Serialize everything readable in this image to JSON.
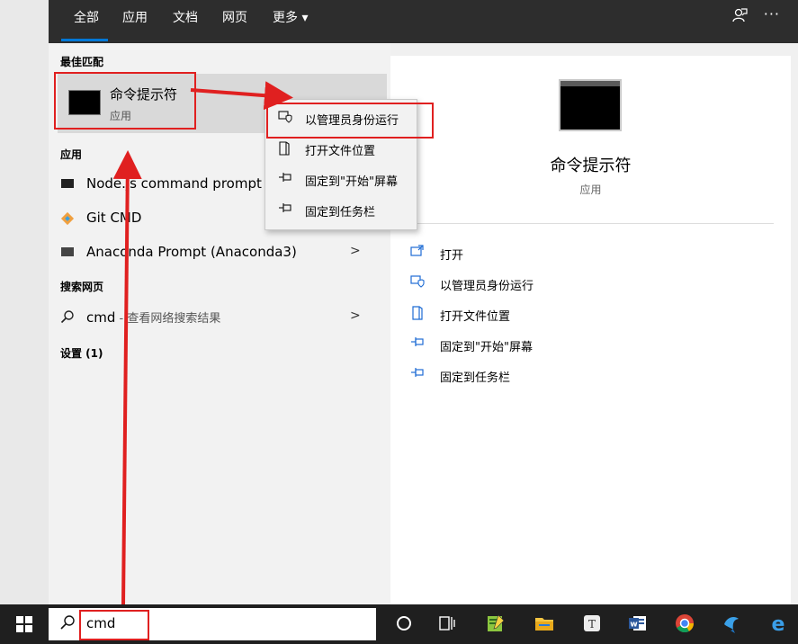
{
  "topbar": {
    "tabs": [
      {
        "label": "全部"
      },
      {
        "label": "应用"
      },
      {
        "label": "文档"
      },
      {
        "label": "网页"
      },
      {
        "label": "更多 ▾"
      }
    ],
    "feedback_icon": "feedback-icon",
    "more_icon": "more-options-icon",
    "more_glyph": "···"
  },
  "results": {
    "best_match_heading": "最佳匹配",
    "best_match": {
      "title": "命令提示符",
      "subtitle": "应用",
      "icon": "terminal-icon"
    },
    "apps_heading": "应用",
    "apps": [
      {
        "label": "Node.js command prompt",
        "icon": "terminal-icon"
      },
      {
        "label": "Git CMD",
        "icon": "git-icon"
      },
      {
        "label": "Anaconda Prompt (Anaconda3)",
        "icon": "terminal-icon",
        "chevron": ">"
      }
    ],
    "web_heading": "搜索网页",
    "web": {
      "query": "cmd",
      "suffix": " - 查看网络搜索结果",
      "chevron": ">"
    },
    "settings_heading": "设置 (1)"
  },
  "context_menu": {
    "items": [
      {
        "label": "以管理员身份运行",
        "icon": "shield-admin-icon"
      },
      {
        "label": "打开文件位置",
        "icon": "file-location-icon"
      },
      {
        "label": "固定到\"开始\"屏幕",
        "icon": "pin-icon"
      },
      {
        "label": "固定到任务栏",
        "icon": "pin-icon"
      }
    ]
  },
  "preview": {
    "title": "命令提示符",
    "subtitle": "应用",
    "actions": [
      {
        "label": "打开",
        "icon": "open-icon"
      },
      {
        "label": "以管理员身份运行",
        "icon": "shield-admin-icon"
      },
      {
        "label": "打开文件位置",
        "icon": "file-location-icon"
      },
      {
        "label": "固定到\"开始\"屏幕",
        "icon": "pin-icon"
      },
      {
        "label": "固定到任务栏",
        "icon": "pin-icon"
      }
    ]
  },
  "taskbar": {
    "search_value": "cmd",
    "icons": [
      "cortana-icon",
      "task-view-icon",
      "notepad-icon",
      "file-explorer-icon",
      "typora-icon",
      "word-icon",
      "chrome-icon",
      "app-icon",
      "edge-icon"
    ]
  },
  "colors": {
    "accent": "#0078d7",
    "highlight": "#e02020",
    "taskbar": "#1f1f1f",
    "topbar": "#2d2d2d"
  }
}
